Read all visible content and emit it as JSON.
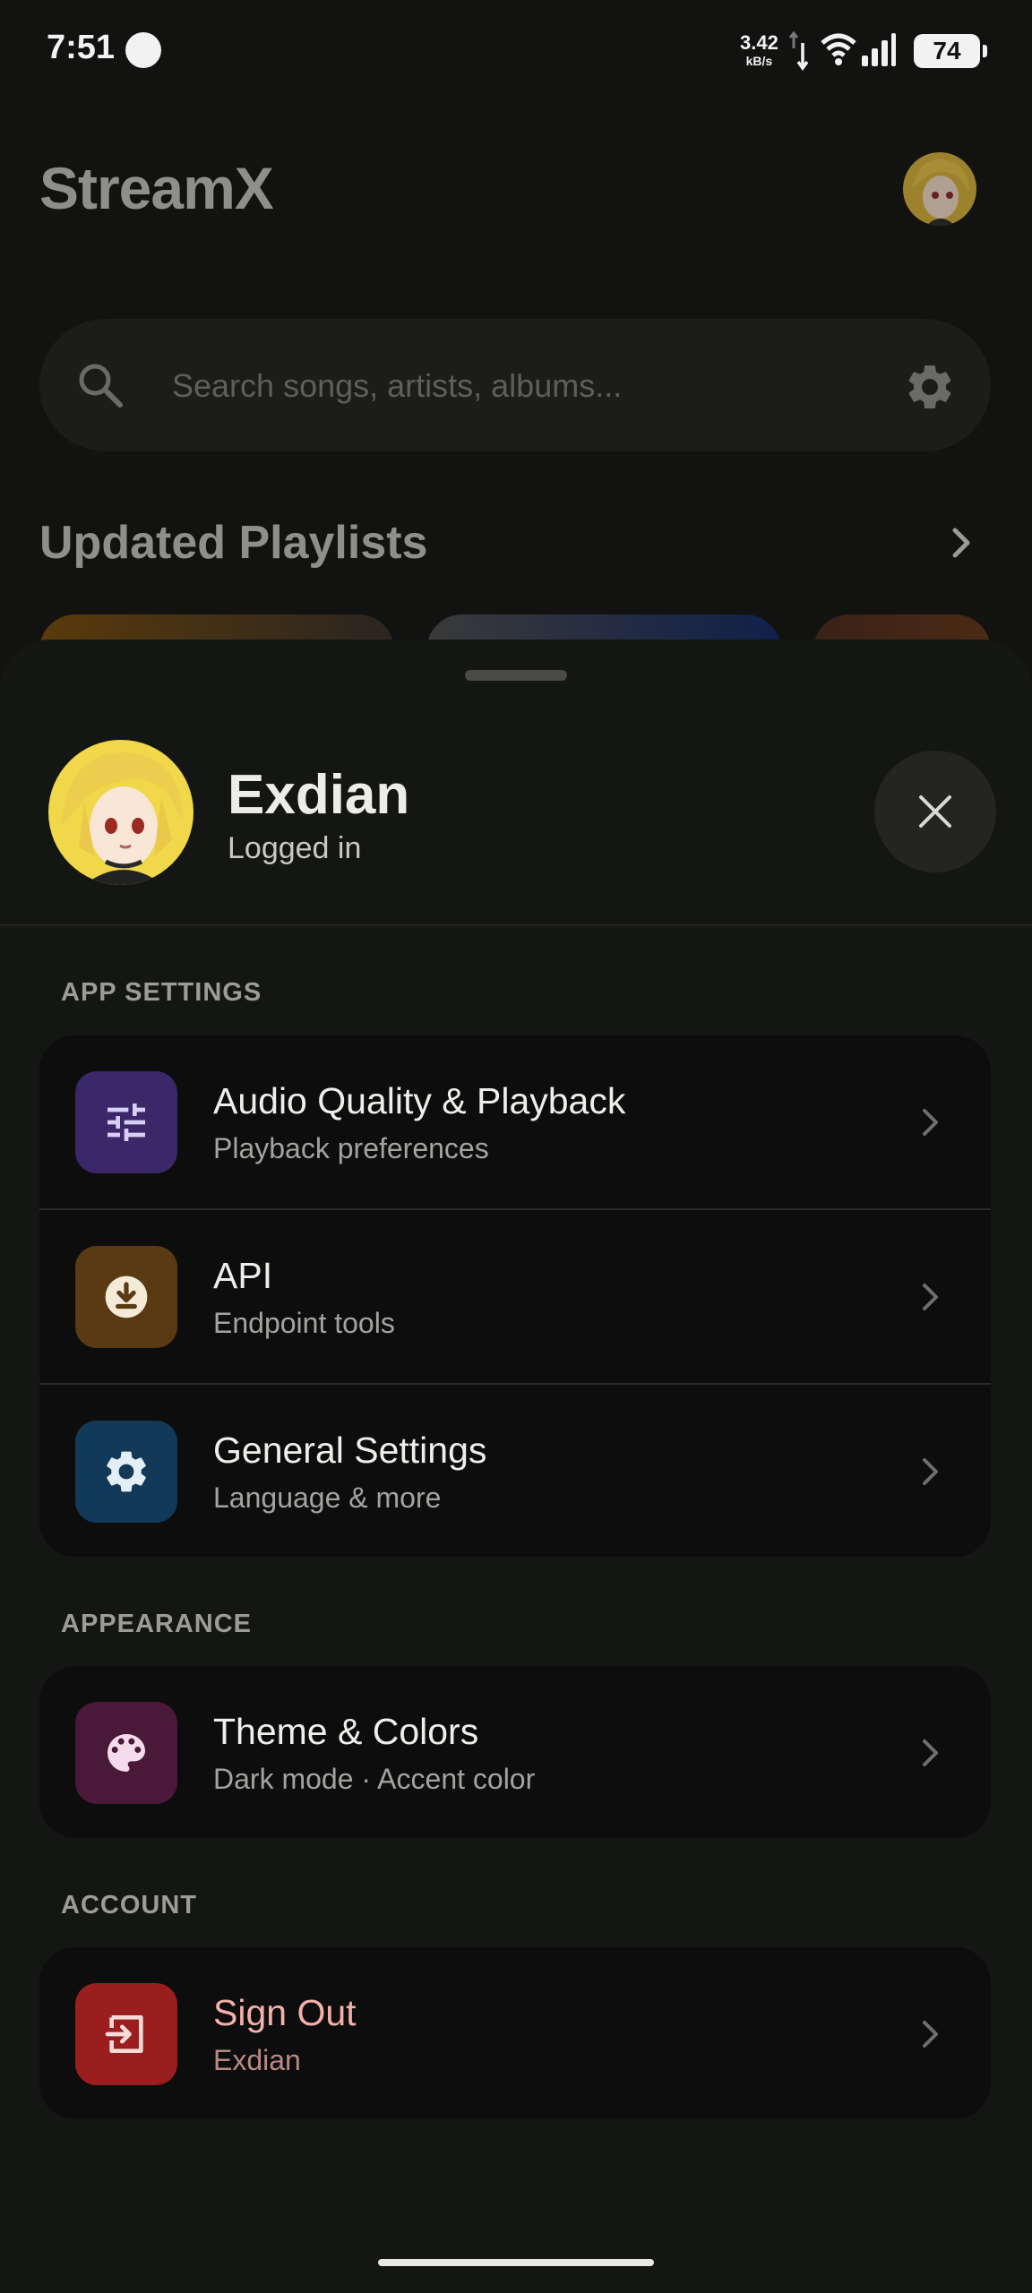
{
  "status_bar": {
    "time": "7:51",
    "speed_value": "3.42",
    "speed_unit": "kB/s",
    "battery": "74"
  },
  "app": {
    "title": "StreamX",
    "search_placeholder": "Search songs, artists, albums...",
    "section_title": "Updated Playlists"
  },
  "profile": {
    "name": "Exdian",
    "status": "Logged in"
  },
  "groups": {
    "app_settings_label": "APP SETTINGS",
    "appearance_label": "APPEARANCE",
    "account_label": "ACCOUNT"
  },
  "items": {
    "audio": {
      "title": "Audio Quality & Playback",
      "subtitle": "Playback preferences",
      "icon": "tune-sliders-icon",
      "color": "#3a2868"
    },
    "api": {
      "title": "API",
      "subtitle": "Endpoint tools",
      "icon": "download-circle-icon",
      "color": "#5a3a12"
    },
    "general": {
      "title": "General Settings",
      "subtitle": "Language & more",
      "icon": "gear-icon",
      "color": "#123a58"
    },
    "theme": {
      "title": "Theme & Colors",
      "subtitle": "Dark mode · Accent color",
      "icon": "palette-icon",
      "color": "#4a1838"
    },
    "signout": {
      "title": "Sign Out",
      "subtitle": "Exdian",
      "icon": "sign-out-icon",
      "color": "#9a1e1e",
      "title_color": "#f4b0aa",
      "subtitle_color": "#b88a86"
    }
  }
}
